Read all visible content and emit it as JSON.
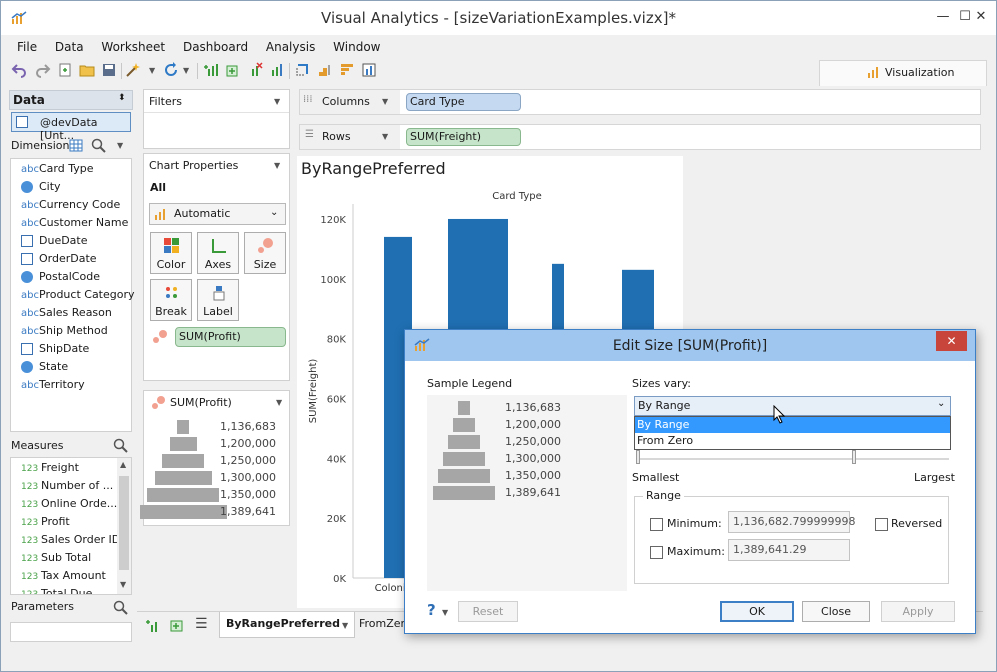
{
  "window": {
    "title": "Visual Analytics - [sizeVariationExamples.vizx]*"
  },
  "menu": [
    "File",
    "Data",
    "Worksheet",
    "Dashboard",
    "Analysis",
    "Window"
  ],
  "visualization_tab": "Visualization",
  "data_panel": {
    "title": "Data",
    "datasource": "@devData [Unt...",
    "dimensions_label": "Dimensions",
    "dimensions": [
      {
        "label": "Card Type",
        "kind": "abc"
      },
      {
        "label": "City",
        "kind": "globe"
      },
      {
        "label": "Currency Code",
        "kind": "abc"
      },
      {
        "label": "Customer Name",
        "kind": "abc"
      },
      {
        "label": "DueDate",
        "kind": "date"
      },
      {
        "label": "OrderDate",
        "kind": "date"
      },
      {
        "label": "PostalCode",
        "kind": "globe"
      },
      {
        "label": "Product Category",
        "kind": "abc"
      },
      {
        "label": "Sales Reason",
        "kind": "abc"
      },
      {
        "label": "Ship Method",
        "kind": "abc"
      },
      {
        "label": "ShipDate",
        "kind": "date"
      },
      {
        "label": "State",
        "kind": "globe"
      },
      {
        "label": "Territory",
        "kind": "abc"
      }
    ],
    "measures_label": "Measures",
    "measures": [
      "Freight",
      "Number of ...",
      "Online Orde...",
      "Profit",
      "Sales Order ID",
      "Sub Total",
      "Tax Amount",
      "Total Due"
    ],
    "parameters_label": "Parameters"
  },
  "filters": {
    "title": "Filters"
  },
  "chart_properties": {
    "title": "Chart Properties",
    "all_label": "All",
    "type_select": "Automatic",
    "buttons": [
      "Color",
      "Axes",
      "Size",
      "Break",
      "Label"
    ],
    "size_pill": "SUM(Profit)"
  },
  "size_legend": {
    "title": "SUM(Profit)",
    "values": [
      "1,136,683",
      "1,200,000",
      "1,250,000",
      "1,300,000",
      "1,350,000",
      "1,389,641"
    ]
  },
  "shelves": {
    "columns_label": "Columns",
    "columns_pill": "Card Type",
    "rows_label": "Rows",
    "rows_pill": "SUM(Freight)"
  },
  "sheet_tabs": [
    "ByRangePreferred",
    "FromZero"
  ],
  "chart_data": {
    "type": "bar",
    "title": "ByRangePreferred",
    "column_header": "Card Type",
    "ylabel": "SUM(Freight)",
    "ylim": [
      0,
      125000
    ],
    "yticks": [
      0,
      20000,
      40000,
      60000,
      80000,
      100000,
      120000
    ],
    "ytick_labels": [
      "0K",
      "20K",
      "40K",
      "60K",
      "80K",
      "100K",
      "120K"
    ],
    "categories": [
      "ColonialV",
      "",
      "",
      ""
    ],
    "values": [
      114000,
      120000,
      105000,
      103000
    ],
    "color": "#1f6fb2"
  },
  "dialog": {
    "title": "Edit Size [SUM(Profit)]",
    "sample_legend_label": "Sample Legend",
    "sample_values": [
      "1,136,683",
      "1,200,000",
      "1,250,000",
      "1,300,000",
      "1,350,000",
      "1,389,641"
    ],
    "sizes_vary_label": "Sizes vary:",
    "sizes_vary_value": "By Range",
    "dropdown_options": [
      "By Range",
      "From Zero"
    ],
    "smallest_label": "Smallest",
    "largest_label": "Largest",
    "range_label": "Range",
    "minimum_label": "Minimum:",
    "minimum_value": "1,136,682.799999998",
    "maximum_label": "Maximum:",
    "maximum_value": "1,389,641.29",
    "reversed_label": "Reversed",
    "help_label": "?",
    "reset_label": "Reset",
    "ok_label": "OK",
    "close_label": "Close",
    "apply_label": "Apply"
  }
}
